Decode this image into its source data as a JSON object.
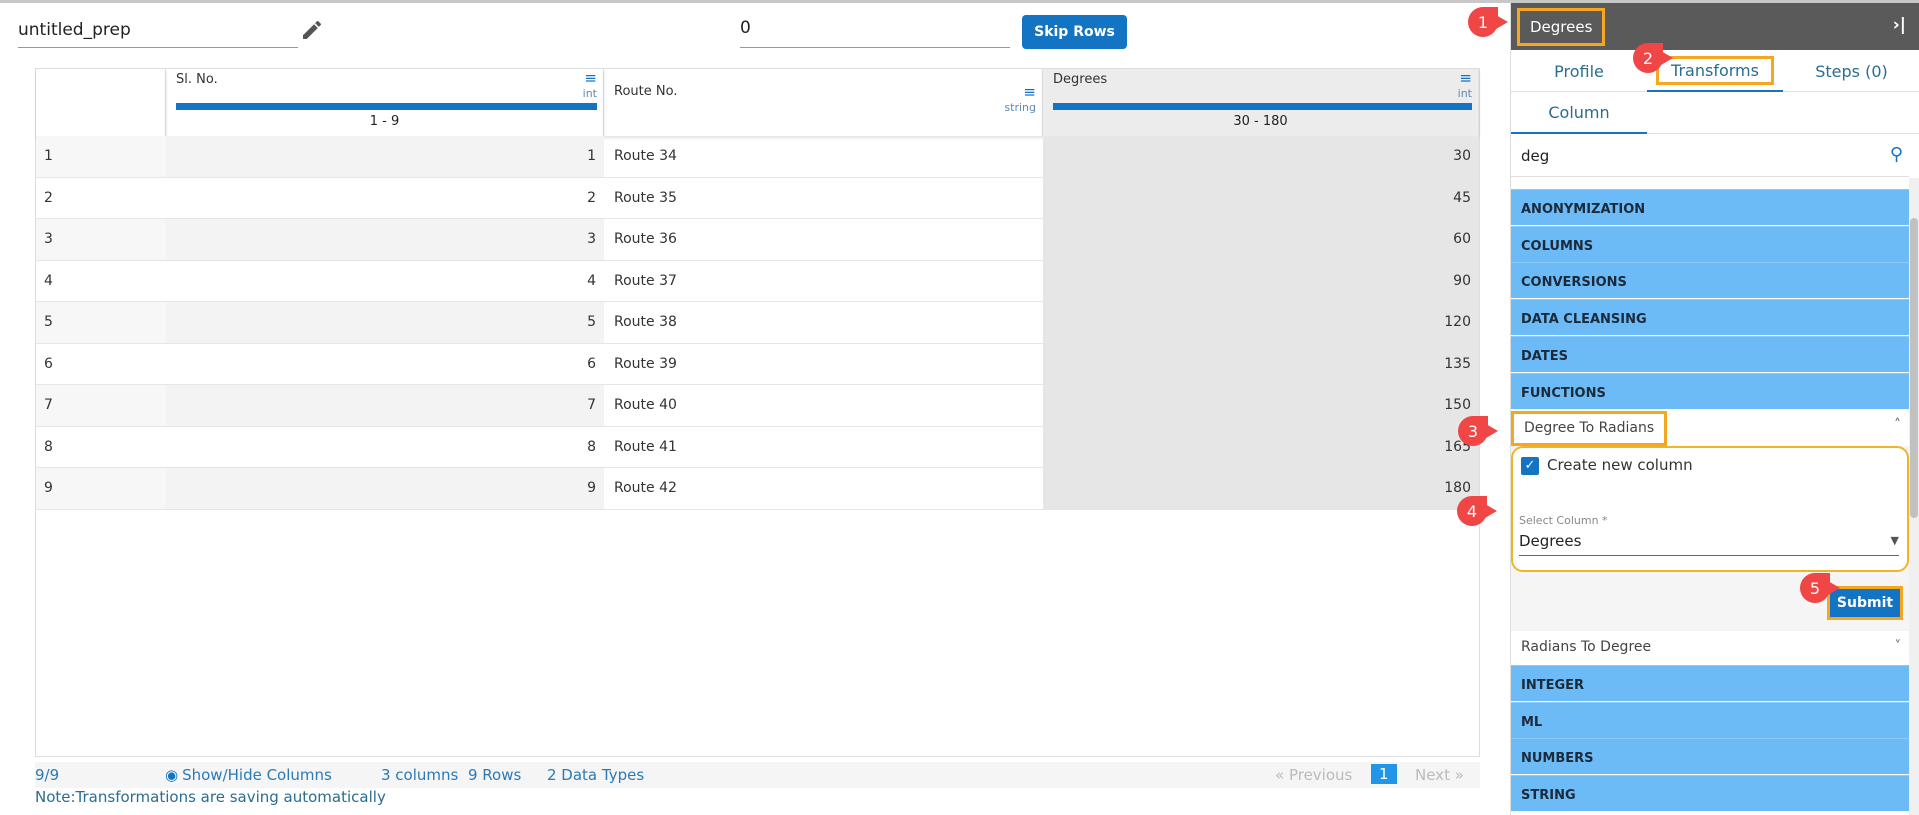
{
  "toolbar": {
    "title": "untitled_prep",
    "skip_value": "0",
    "skip_label": "Skip Rows"
  },
  "table": {
    "columns": [
      {
        "name": "Sl. No.",
        "type": "int",
        "range": "1 - 9"
      },
      {
        "name": "Route No.",
        "type": "string"
      },
      {
        "name": "Degrees",
        "type": "int",
        "range": "30 - 180"
      }
    ],
    "rows": [
      [
        "1",
        "1",
        "Route 34",
        "30"
      ],
      [
        "2",
        "2",
        "Route 35",
        "45"
      ],
      [
        "3",
        "3",
        "Route 36",
        "60"
      ],
      [
        "4",
        "4",
        "Route 37",
        "90"
      ],
      [
        "5",
        "5",
        "Route 38",
        "120"
      ],
      [
        "6",
        "6",
        "Route 39",
        "135"
      ],
      [
        "7",
        "7",
        "Route 40",
        "150"
      ],
      [
        "8",
        "8",
        "Route 41",
        "165"
      ],
      [
        "9",
        "9",
        "Route 42",
        "180"
      ]
    ]
  },
  "footer": {
    "count": "9/9",
    "show_hide": "Show/Hide Columns",
    "columns": "3 columns",
    "rows": "9 Rows",
    "types": "2 Data Types",
    "prev": "« Previous",
    "page": "1",
    "next": "Next »",
    "note": "Note:Transformations are saving automatically"
  },
  "panel": {
    "title": "Degrees",
    "collapse": "›|",
    "tabs": [
      "Profile",
      "Transforms",
      "Steps (0)"
    ],
    "subtab": "Column",
    "search": "deg",
    "categories_top": [
      "ANONYMIZATION",
      "COLUMNS",
      "CONVERSIONS",
      "DATA CLEANSING",
      "DATES",
      "FUNCTIONS"
    ],
    "expanded": {
      "title": "Degree To Radians",
      "checkbox_label": "Create new column",
      "select_label": "Select Column *",
      "select_value": "Degrees",
      "submit": "Submit"
    },
    "collapsed": "Radians To Degree",
    "categories_bottom": [
      "INTEGER",
      "ML",
      "NUMBERS",
      "STRING"
    ]
  },
  "callouts": [
    "1",
    "2",
    "3",
    "4",
    "5"
  ],
  "colors": {
    "accent": "#1474c4",
    "category": "#6cbbf7",
    "highlight": "#f5a623",
    "callout": "#f04646"
  }
}
